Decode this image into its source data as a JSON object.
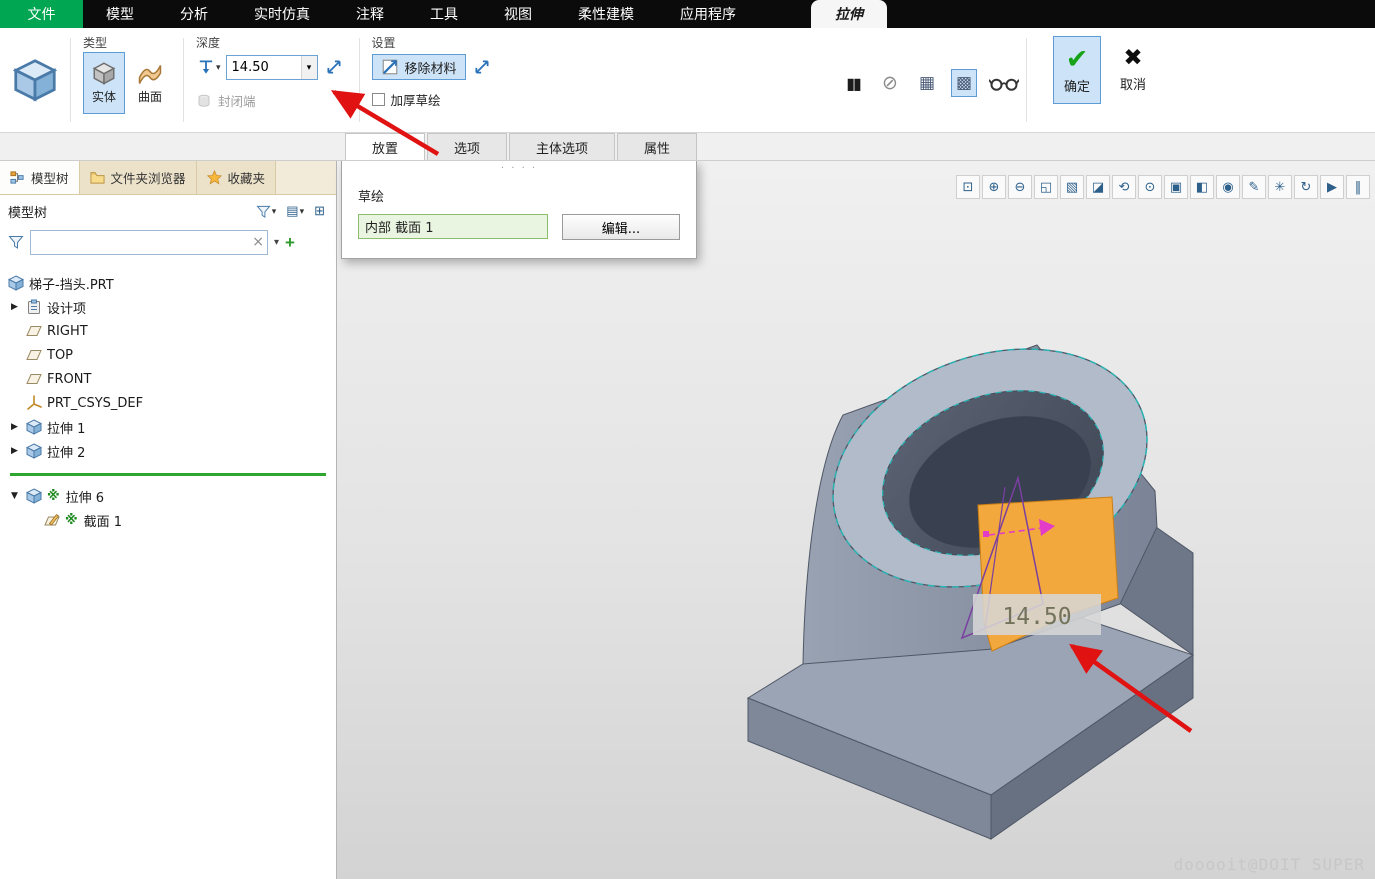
{
  "menubar": {
    "file": "文件",
    "items": [
      "模型",
      "分析",
      "实时仿真",
      "注释",
      "工具",
      "视图",
      "柔性建模",
      "应用程序"
    ],
    "context_tab": "拉伸"
  },
  "ribbon": {
    "type_group": {
      "label": "类型",
      "solid": "实体",
      "surface": "曲面"
    },
    "depth_group": {
      "label": "深度",
      "value": "14.50",
      "capped_ends": "封闭端"
    },
    "settings_group": {
      "label": "设置",
      "remove_material": "移除材料",
      "thicken_sketch": "加厚草绘"
    },
    "ok_label": "确定",
    "cancel_label": "取消"
  },
  "dashboard_tabs": {
    "placement": "放置",
    "options": "选项",
    "body_options": "主体选项",
    "properties": "属性"
  },
  "placement_panel": {
    "sketch_label": "草绘",
    "section_value": "内部 截面 1",
    "edit_label": "编辑..."
  },
  "sidebar": {
    "tab_model_tree": "模型树",
    "tab_folder_browser": "文件夹浏览器",
    "tab_favorites": "收藏夹",
    "header": "模型树",
    "tree": {
      "part": "梯子-挡头.PRT",
      "design_items": "设计项",
      "plane_right": "RIGHT",
      "plane_top": "TOP",
      "plane_front": "FRONT",
      "csys": "PRT_CSYS_DEF",
      "extrude1": "拉伸 1",
      "extrude2": "拉伸 2",
      "extrude6": "拉伸 6",
      "section1": "截面 1",
      "pending_marker": "※"
    }
  },
  "viewport": {
    "dimension_value": "14.50",
    "watermark": "dooooit@DOIT SUPER"
  },
  "icons": {
    "dropdown": "▾",
    "expander_collapsed": "▶",
    "expander_expanded": "▼",
    "clear": "×",
    "add": "+",
    "list": "▤",
    "settings_grid": "⊞",
    "grip_dots": "· · · ·",
    "pause_large": "▮▮",
    "no_preview": "⊘",
    "wireframe_preview": "▦",
    "attached_preview": "▩",
    "ok_check": "✔",
    "cancel_x": "✖",
    "zoom_region": "⊡",
    "zoom_in": "⊕",
    "zoom_out": "⊖",
    "refit": "◱",
    "repaint": "▧",
    "display_style": "◪",
    "saved_orientations": "⟲",
    "view_normal": "⊙",
    "capture": "▣",
    "section": "◧",
    "appearance": "◉",
    "annotations": "✎",
    "datum_display": "✳",
    "spin_center": "↻",
    "dragger": "▶",
    "pause": "‖"
  },
  "colors": {
    "file_menu_green": "#00a651",
    "selection_blue": "#cde3f7",
    "highlight_orange": "#f2a83c",
    "arrow_red": "#e01212",
    "insert_locator_green": "#2ea52e"
  }
}
